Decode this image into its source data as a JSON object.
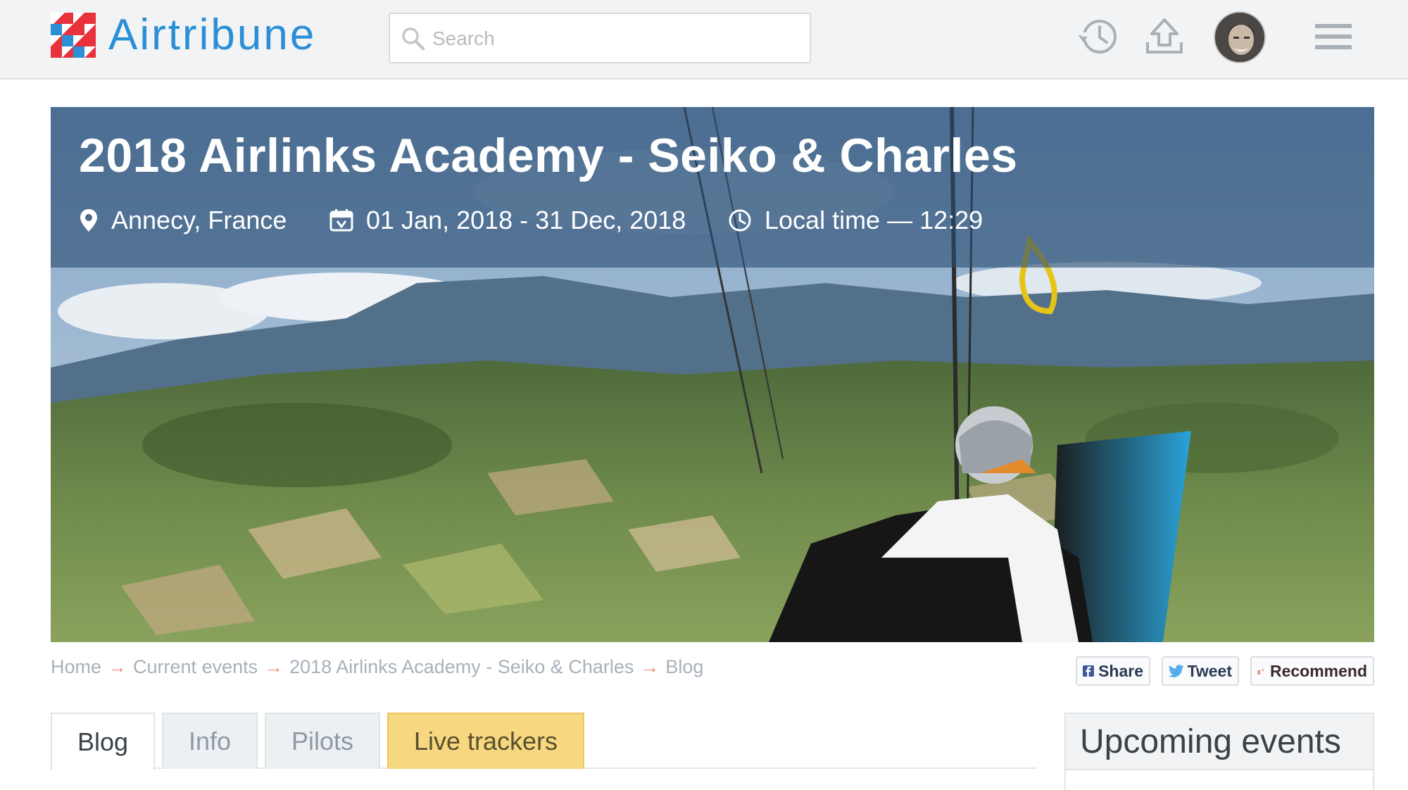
{
  "header": {
    "brand": "Airtribune",
    "search_placeholder": "Search"
  },
  "event": {
    "title": "2018 Airlinks Academy - Seiko & Charles",
    "location": "Annecy, France",
    "dates": "01 Jan, 2018 - 31 Dec, 2018",
    "local_time": "Local time — 12:29"
  },
  "breadcrumb": [
    "Home",
    "Current events",
    "2018 Airlinks Academy - Seiko & Charles",
    "Blog"
  ],
  "breadcrumb_separator": "→",
  "social": {
    "share": "Share",
    "tweet": "Tweet",
    "recommend": "Recommend"
  },
  "tabs": [
    "Blog",
    "Info",
    "Pilots",
    "Live trackers"
  ],
  "active_tab": "Blog",
  "sidebar": {
    "upcoming_title": "Upcoming events"
  },
  "colors": {
    "brand_blue": "#2a8fd6",
    "brand_red": "#e8323c",
    "live_tab": "#f7d77f",
    "breadcrumb_arrow": "#f08c7a"
  },
  "icons": [
    "logo-icon",
    "search-icon",
    "history-icon",
    "upload-icon",
    "avatar",
    "menu-icon",
    "location-pin-icon",
    "calendar-icon",
    "clock-icon",
    "facebook-icon",
    "twitter-icon",
    "google-plus-icon"
  ]
}
